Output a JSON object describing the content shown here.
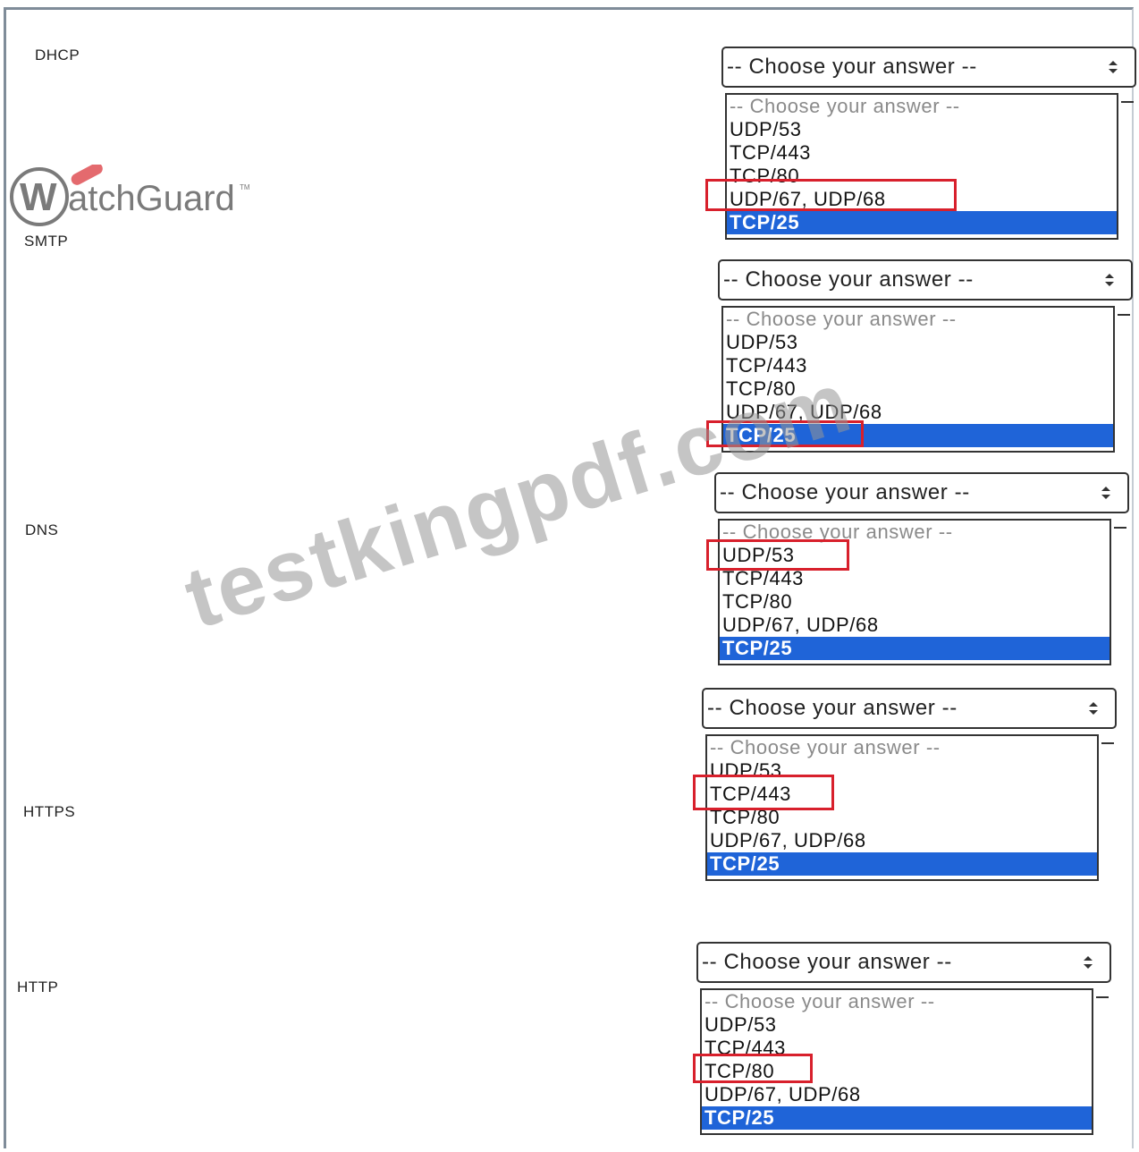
{
  "logo": {
    "text": "WatchGuard",
    "accent_color": "#e46a6e",
    "mark_color": "#7a7a7a"
  },
  "watermark": {
    "text": "testkingpdf.com"
  },
  "colors": {
    "selected_bg": "#1f64d8",
    "highlight_border": "#d8202c"
  },
  "questions": [
    {
      "label": "DHCP",
      "select_value": "-- Choose your answer --",
      "options": [
        "-- Choose your answer --",
        "UDP/53",
        "TCP/443",
        "TCP/80",
        "UDP/67, UDP/68",
        "TCP/25"
      ],
      "selected_index": 5,
      "answer_index": 4
    },
    {
      "label": "SMTP",
      "select_value": "-- Choose your answer --",
      "options": [
        "-- Choose your answer --",
        "UDP/53",
        "TCP/443",
        "TCP/80",
        "UDP/67, UDP/68",
        "TCP/25"
      ],
      "selected_index": 5,
      "answer_index": 5
    },
    {
      "label": "DNS",
      "select_value": "-- Choose your answer --",
      "options": [
        "-- Choose your answer --",
        "UDP/53",
        "TCP/443",
        "TCP/80",
        "UDP/67, UDP/68",
        "TCP/25"
      ],
      "selected_index": 5,
      "answer_index": 1
    },
    {
      "label": "HTTPS",
      "select_value": "-- Choose your answer --",
      "options": [
        "-- Choose your answer --",
        "UDP/53",
        "TCP/443",
        "TCP/80",
        "UDP/67, UDP/68",
        "TCP/25"
      ],
      "selected_index": 5,
      "answer_index": 2
    },
    {
      "label": "HTTP",
      "select_value": "-- Choose your answer --",
      "options": [
        "-- Choose your answer --",
        "UDP/53",
        "TCP/443",
        "TCP/80",
        "UDP/67, UDP/68",
        "TCP/25"
      ],
      "selected_index": 5,
      "answer_index": 3
    }
  ]
}
